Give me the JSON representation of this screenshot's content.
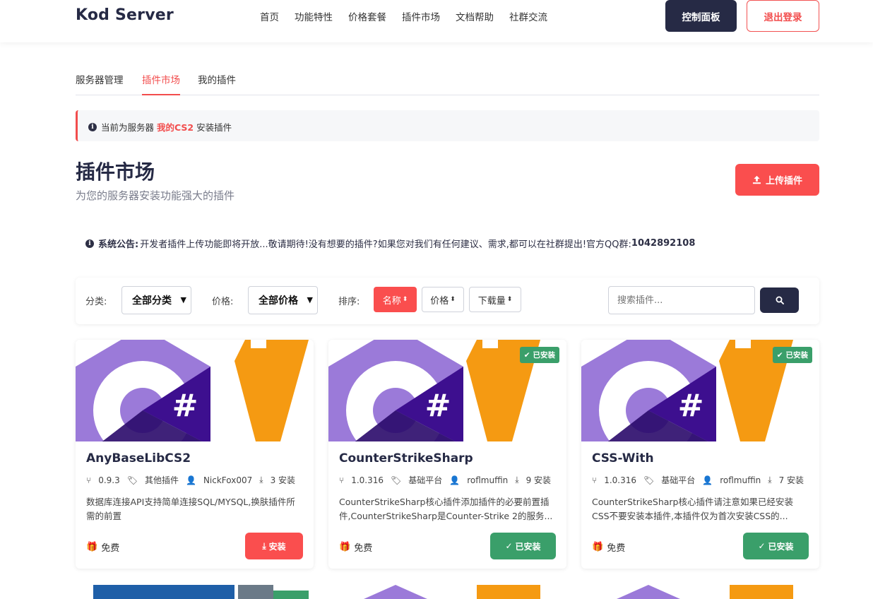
{
  "header": {
    "brand": "Kod Server",
    "nav": [
      "首页",
      "功能特性",
      "价格套餐",
      "插件市场",
      "文档帮助",
      "社群交流"
    ],
    "console_label": "控制面板",
    "logout_label": "退出登录"
  },
  "tabs": [
    "服务器管理",
    "插件市场",
    "我的插件"
  ],
  "notice": {
    "prefix": "当前为服务器",
    "server": "我的CS2",
    "suffix": "安装插件"
  },
  "page": {
    "title": "插件市场",
    "subtitle": "为您的服务器安装功能强大的插件",
    "upload_label": "上传插件"
  },
  "announcement": {
    "label": "系统公告:",
    "text": "开发者插件上传功能即将开放...敬请期待!没有想要的插件?如果您对我们有任何建议、需求,都可以在社群提出!官方QQ群:",
    "qq": "1042892108"
  },
  "filters": {
    "category_label": "分类:",
    "category_value": "全部分类",
    "price_label": "价格:",
    "price_value": "全部价格",
    "sort_label": "排序:",
    "sort_options": [
      "名称",
      "价格",
      "下载量"
    ],
    "search_placeholder": "搜索插件..."
  },
  "colors": {
    "accent": "#fa4e4e",
    "dark": "#262a45",
    "success": "#3a9f6a",
    "csharp_purple": "#9b7ad9",
    "csharp_dark": "#3d0f8f",
    "orange": "#f59a12"
  },
  "plugins": [
    {
      "name": "AnyBaseLibCS2",
      "version": "0.9.3",
      "category": "其他插件",
      "author": "NickFox007",
      "installs": "3 安装",
      "desc": "数据库连接API支持简单连接SQL/MYSQL,换肤插件所需的前置",
      "price": "免费",
      "action": "安装",
      "installed": false
    },
    {
      "name": "CounterStrikeSharp",
      "version": "1.0.316",
      "category": "基础平台",
      "author": "roflmuffin",
      "installs": "9 安装",
      "desc": "CounterStrikeSharp核心插件添加插件的必要前置插件,CounterStrikeSharp是Counter-Strike 2的服务...",
      "price": "免费",
      "action": "已安装",
      "installed": true,
      "badge": "已安装"
    },
    {
      "name": "CSS-With",
      "version": "1.0.316",
      "category": "基础平台",
      "author": "roflmuffin",
      "installs": "7 安装",
      "desc": "CounterStrikeSharp核心插件请注意如果已经安装CSS不要安装本插件,本插件仅为首次安装CSS的...",
      "price": "免费",
      "action": "已安装",
      "installed": true,
      "badge": "已安装"
    }
  ]
}
